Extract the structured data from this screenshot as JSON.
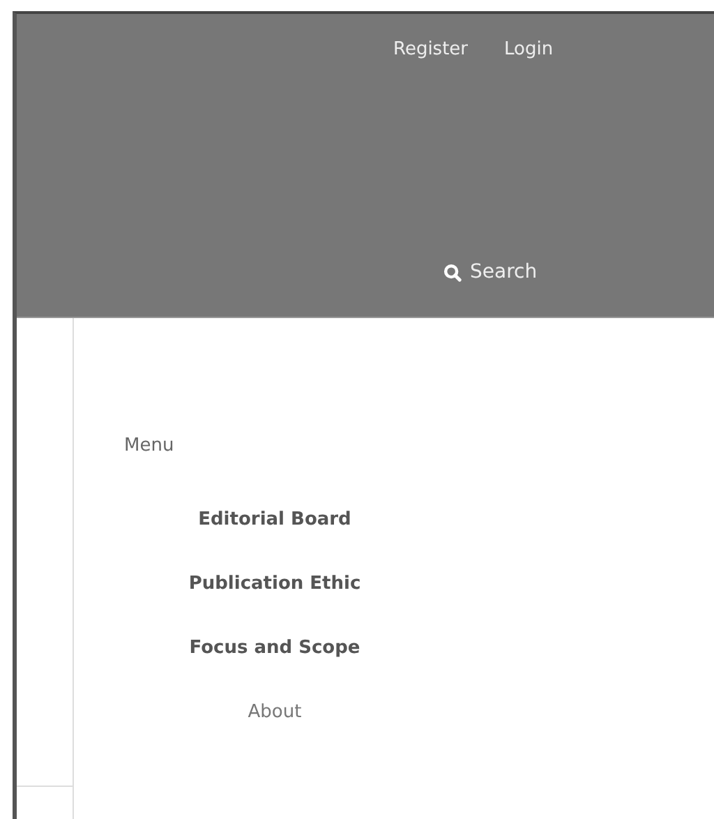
{
  "header": {
    "links": [
      "Register",
      "Login"
    ],
    "search": "Search"
  },
  "menu": {
    "title": "Menu",
    "items": [
      {
        "label": "Editorial Board",
        "bold": true
      },
      {
        "label": "Publication Ethic",
        "bold": true
      },
      {
        "label": "Focus and Scope",
        "bold": true
      },
      {
        "label": "About",
        "bold": false
      }
    ]
  }
}
